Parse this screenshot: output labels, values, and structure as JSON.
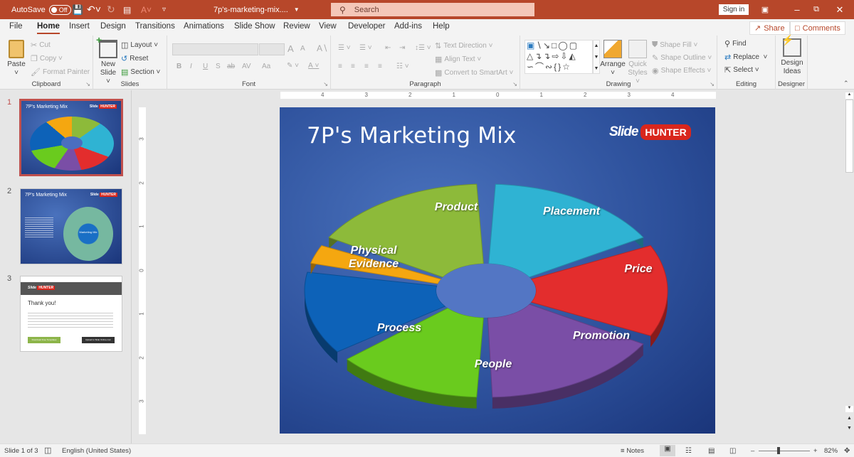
{
  "titlebar": {
    "autosave_label": "AutoSave",
    "autosave_state": "Off",
    "filename": "7p's-marketing-mix....",
    "search_placeholder": "Search",
    "signin": "Sign in",
    "accent": "#b7472a"
  },
  "menu": {
    "tabs": [
      "File",
      "Home",
      "Insert",
      "Design",
      "Transitions",
      "Animations",
      "Slide Show",
      "Review",
      "View",
      "Developer",
      "Add-ins",
      "Help"
    ],
    "active": "Home",
    "share": "Share",
    "comments": "Comments"
  },
  "ribbon": {
    "clipboard": {
      "label": "Clipboard",
      "paste": "Paste",
      "cut": "Cut",
      "copy": "Copy",
      "format_painter": "Format Painter"
    },
    "slides": {
      "label": "Slides",
      "new_slide_1": "New",
      "new_slide_2": "Slide",
      "layout": "Layout",
      "reset": "Reset",
      "section": "Section"
    },
    "font": {
      "label": "Font",
      "bold": "B",
      "italic": "I",
      "underline": "U",
      "strike": "S",
      "shadow": "ab",
      "spacing": "AV",
      "case": "Aa",
      "grow": "A",
      "shrink": "A"
    },
    "paragraph": {
      "label": "Paragraph",
      "text_direction": "Text Direction",
      "align_text": "Align Text",
      "convert_smartart": "Convert to SmartArt"
    },
    "drawing": {
      "label": "Drawing",
      "arrange": "Arrange",
      "quick_1": "Quick",
      "quick_2": "Styles",
      "shape_fill": "Shape Fill",
      "shape_outline": "Shape Outline",
      "shape_effects": "Shape Effects"
    },
    "editing": {
      "label": "Editing",
      "find": "Find",
      "replace": "Replace",
      "select": "Select"
    },
    "designer": {
      "label": "Designer",
      "design_1": "Design",
      "design_2": "Ideas"
    }
  },
  "thumbnails": [
    {
      "num": "1",
      "title": "7P's Marketing Mix",
      "selected": true
    },
    {
      "num": "2",
      "title": "7P's Marketing Mix",
      "center": "Marketing Mix"
    },
    {
      "num": "3",
      "title": "Thank you!",
      "btn1": "Download Free Templates",
      "btn2": "Upload to Slide Online.com"
    }
  ],
  "ruler": {
    "horizontal": [
      "4",
      "3",
      "2",
      "1",
      "0",
      "1",
      "2",
      "3",
      "4"
    ],
    "vertical": [
      "3",
      "2",
      "1",
      "0",
      "1",
      "2",
      "3"
    ]
  },
  "slide": {
    "title": "7P's Marketing Mix",
    "logo_slide": "Slide",
    "logo_hunter": "HUNTER",
    "segments": [
      {
        "label": "Product",
        "color": "#8dba3a"
      },
      {
        "label": "Placement",
        "color": "#2fb3d3"
      },
      {
        "label": "Price",
        "color": "#e32d2d"
      },
      {
        "label": "Promotion",
        "color": "#7a4ea6"
      },
      {
        "label": "People",
        "color": "#6acb1e"
      },
      {
        "label": "Process",
        "color": "#0d62b8"
      },
      {
        "label": "Physical Evidence",
        "color": "#f5a710"
      }
    ]
  },
  "status": {
    "slide_of": "Slide 1 of 3",
    "language": "English (United States)",
    "notes": "Notes",
    "zoom": "82%"
  }
}
